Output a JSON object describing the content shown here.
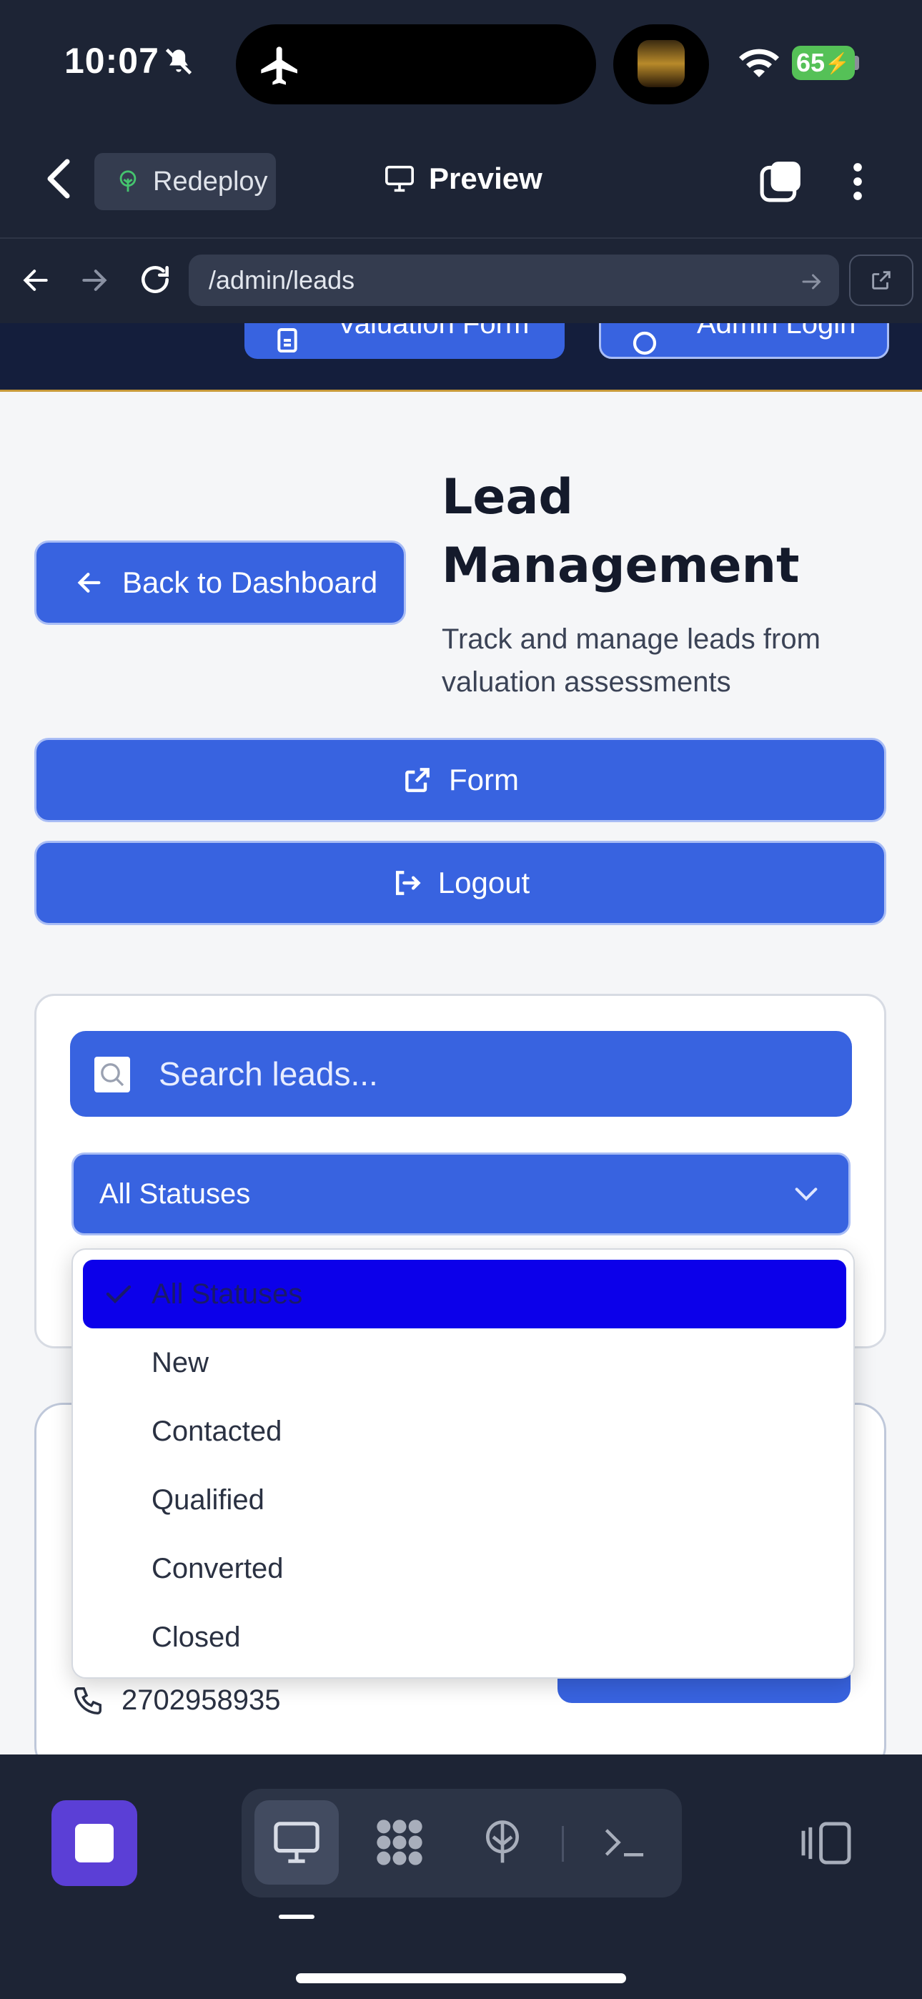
{
  "status_bar": {
    "time": "10:07",
    "battery": "65"
  },
  "app_header": {
    "redeploy_label": "Redeploy",
    "preview_label": "Preview"
  },
  "browser": {
    "url": "/admin/leads"
  },
  "site_header": {
    "valuation_form_label": "Valuation Form",
    "admin_login_label": "Admin Login"
  },
  "page": {
    "back_label": "Back to Dashboard",
    "title": "Lead Management",
    "subtitle": "Track and manage leads from valuation assessments",
    "form_label": "Form",
    "logout_label": "Logout"
  },
  "filters": {
    "search_placeholder": "Search leads...",
    "status_selected": "All Statuses",
    "status_options": [
      "All Statuses",
      "New",
      "Contacted",
      "Qualified",
      "Converted",
      "Closed"
    ]
  },
  "lead": {
    "phone": "2702958935"
  },
  "colors": {
    "primary": "#3863e0",
    "header_bg": "#1d2435",
    "selected_option": "#0c00ea",
    "stop_button": "#5b3fd6"
  }
}
